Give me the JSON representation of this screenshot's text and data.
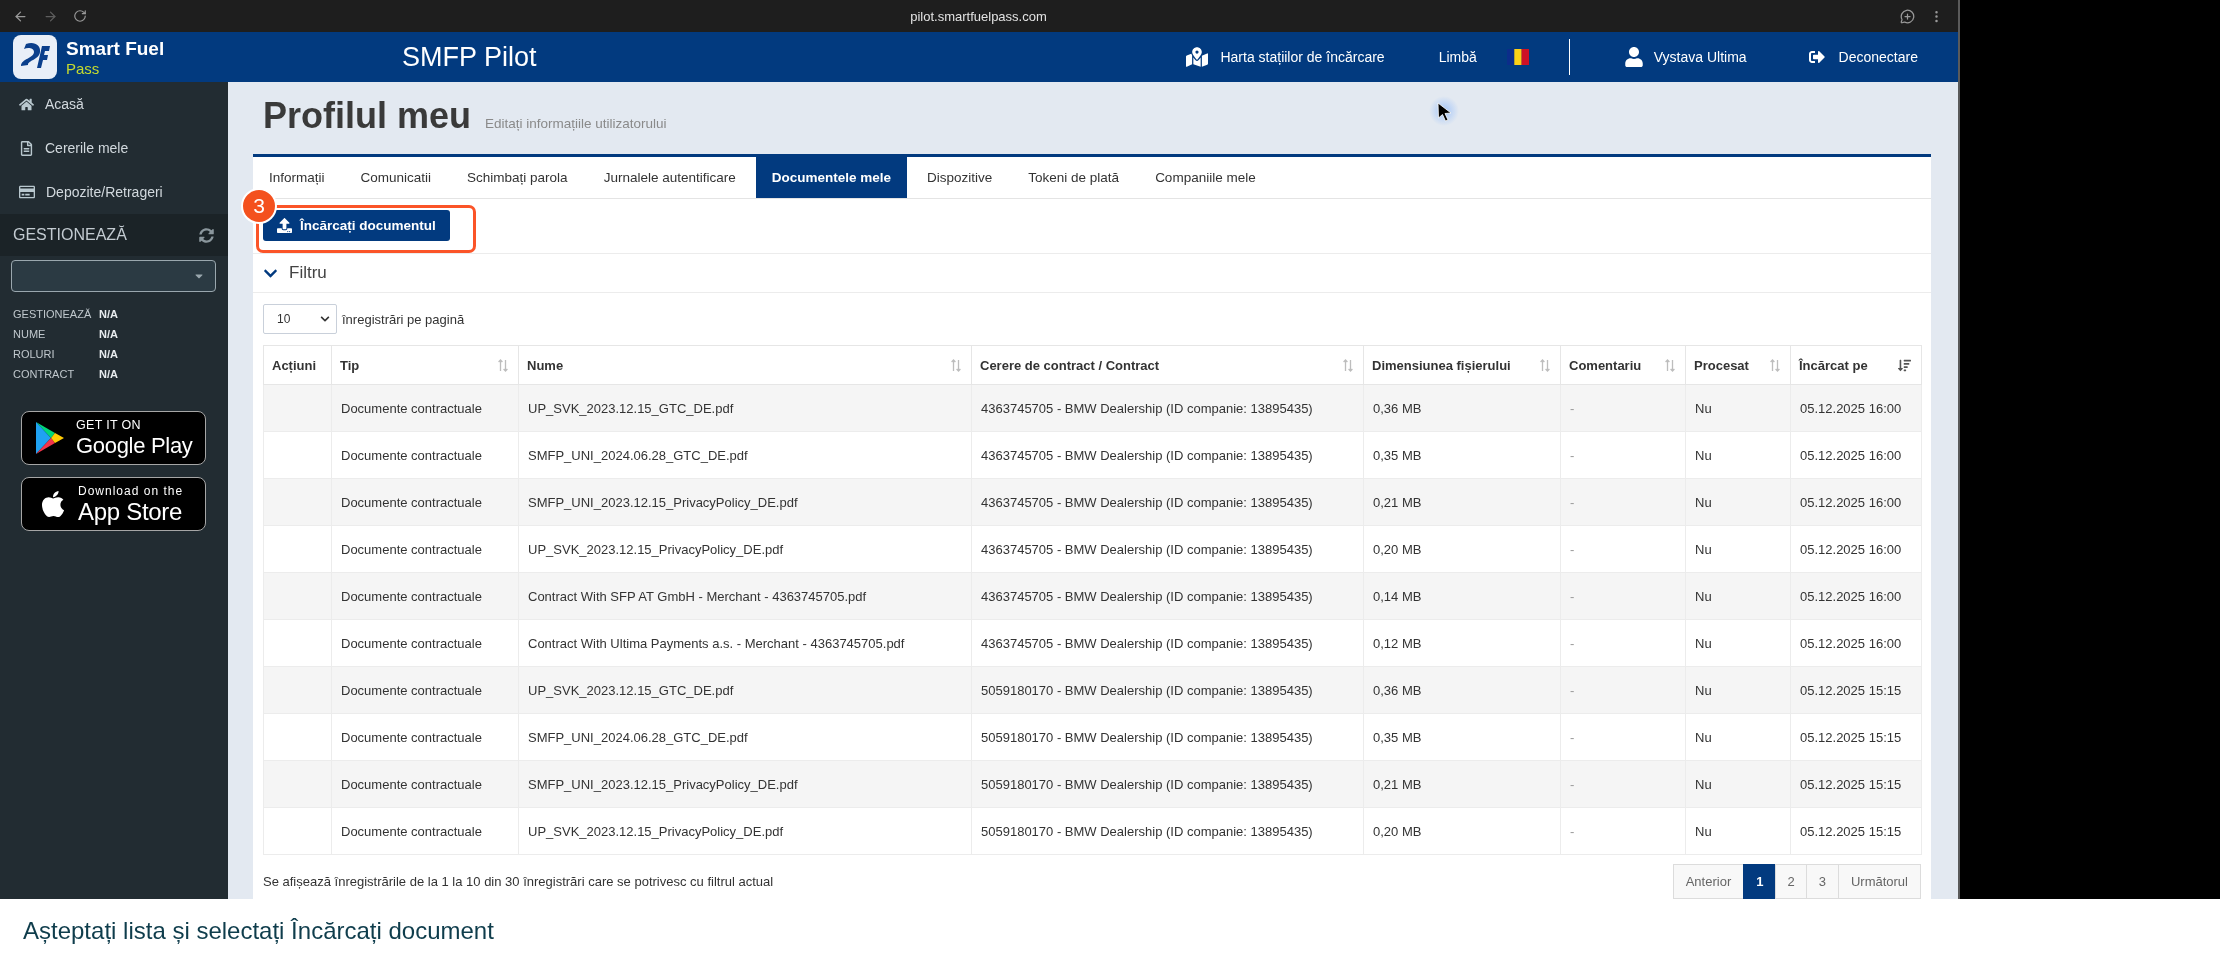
{
  "browser": {
    "url": "pilot.smartfuelpass.com"
  },
  "header": {
    "brand": {
      "name": "Smart Fuel",
      "tagline": "Pass"
    },
    "app_title": "SMFP Pilot",
    "map_link": "Harta stațiilor de încărcare",
    "language_label": "Limbă",
    "user_name": "Vystava Ultima",
    "logout": "Deconectare"
  },
  "sidebar": {
    "nav": [
      {
        "label": "Acasă"
      },
      {
        "label": "Cererile mele"
      },
      {
        "label": "Depozite/Retrageri"
      }
    ],
    "manage": {
      "title": "GESTIONEAZĂ",
      "details": [
        {
          "label": "GESTIONEAZĂ",
          "value": "N/A"
        },
        {
          "label": "NUME",
          "value": "N/A"
        },
        {
          "label": "ROLURI",
          "value": "N/A"
        },
        {
          "label": "CONTRACT",
          "value": "N/A"
        }
      ]
    },
    "stores": [
      {
        "kind": "google_play",
        "top": "GET IT ON",
        "name": "Google Play"
      },
      {
        "kind": "app_store",
        "top": "Download on the",
        "name": "App Store"
      }
    ]
  },
  "page": {
    "title": "Profilul meu",
    "subtitle": "Editați informațiile utilizatorului"
  },
  "tabs": [
    {
      "label": "Informații",
      "selected": false
    },
    {
      "label": "Comunicatii",
      "selected": false
    },
    {
      "label": "Schimbați parola",
      "selected": false
    },
    {
      "label": "Jurnalele autentificare",
      "selected": false
    },
    {
      "label": "Documentele mele",
      "selected": true
    },
    {
      "label": "Dispozitive",
      "selected": false
    },
    {
      "label": "Tokeni de plată",
      "selected": false
    },
    {
      "label": "Companiile mele",
      "selected": false
    }
  ],
  "upload": {
    "label": "Încărcați documentul",
    "step": "3"
  },
  "filter": {
    "label": "Filtru"
  },
  "page_length": {
    "value": "10",
    "label": "înregistrări pe pagină"
  },
  "table": {
    "columns": [
      {
        "label": "Acțiuni",
        "sortable": false,
        "sorted_descending": false
      },
      {
        "label": "Tip",
        "sortable": true,
        "sorted_descending": false
      },
      {
        "label": "Nume",
        "sortable": true,
        "sorted_descending": false
      },
      {
        "label": "Cerere de contract / Contract",
        "sortable": true,
        "sorted_descending": false
      },
      {
        "label": "Dimensiunea fișierului",
        "sortable": true,
        "sorted_descending": false
      },
      {
        "label": "Comentariu",
        "sortable": true,
        "sorted_descending": false
      },
      {
        "label": "Procesat",
        "sortable": true,
        "sorted_descending": false
      },
      {
        "label": "Încărcat pe",
        "sortable": true,
        "sorted_descending": true
      }
    ],
    "rows": [
      {
        "type": "Documente contractuale",
        "name": "UP_SVK_2023.12.15_GTC_DE.pdf",
        "contract": "4363745705 - BMW Dealership (ID companie: 13895435)",
        "size": "0,36 MB",
        "comment": "-",
        "processed": "Nu",
        "uploaded": "05.12.2025 16:00"
      },
      {
        "type": "Documente contractuale",
        "name": "SMFP_UNI_2024.06.28_GTC_DE.pdf",
        "contract": "4363745705 - BMW Dealership (ID companie: 13895435)",
        "size": "0,35 MB",
        "comment": "-",
        "processed": "Nu",
        "uploaded": "05.12.2025 16:00"
      },
      {
        "type": "Documente contractuale",
        "name": "SMFP_UNI_2023.12.15_PrivacyPolicy_DE.pdf",
        "contract": "4363745705 - BMW Dealership (ID companie: 13895435)",
        "size": "0,21 MB",
        "comment": "-",
        "processed": "Nu",
        "uploaded": "05.12.2025 16:00"
      },
      {
        "type": "Documente contractuale",
        "name": "UP_SVK_2023.12.15_PrivacyPolicy_DE.pdf",
        "contract": "4363745705 - BMW Dealership (ID companie: 13895435)",
        "size": "0,20 MB",
        "comment": "-",
        "processed": "Nu",
        "uploaded": "05.12.2025 16:00"
      },
      {
        "type": "Documente contractuale",
        "name": "Contract With SFP AT GmbH - Merchant - 4363745705.pdf",
        "contract": "4363745705 - BMW Dealership (ID companie: 13895435)",
        "size": "0,14 MB",
        "comment": "-",
        "processed": "Nu",
        "uploaded": "05.12.2025 16:00"
      },
      {
        "type": "Documente contractuale",
        "name": "Contract With Ultima Payments a.s. - Merchant - 4363745705.pdf",
        "contract": "4363745705 - BMW Dealership (ID companie: 13895435)",
        "size": "0,12 MB",
        "comment": "-",
        "processed": "Nu",
        "uploaded": "05.12.2025 16:00"
      },
      {
        "type": "Documente contractuale",
        "name": "UP_SVK_2023.12.15_GTC_DE.pdf",
        "contract": "5059180170 - BMW Dealership (ID companie: 13895435)",
        "size": "0,36 MB",
        "comment": "-",
        "processed": "Nu",
        "uploaded": "05.12.2025 15:15"
      },
      {
        "type": "Documente contractuale",
        "name": "SMFP_UNI_2024.06.28_GTC_DE.pdf",
        "contract": "5059180170 - BMW Dealership (ID companie: 13895435)",
        "size": "0,35 MB",
        "comment": "-",
        "processed": "Nu",
        "uploaded": "05.12.2025 15:15"
      },
      {
        "type": "Documente contractuale",
        "name": "SMFP_UNI_2023.12.15_PrivacyPolicy_DE.pdf",
        "contract": "5059180170 - BMW Dealership (ID companie: 13895435)",
        "size": "0,21 MB",
        "comment": "-",
        "processed": "Nu",
        "uploaded": "05.12.2025 15:15"
      },
      {
        "type": "Documente contractuale",
        "name": "UP_SVK_2023.12.15_PrivacyPolicy_DE.pdf",
        "contract": "5059180170 - BMW Dealership (ID companie: 13895435)",
        "size": "0,20 MB",
        "comment": "-",
        "processed": "Nu",
        "uploaded": "05.12.2025 15:15"
      }
    ]
  },
  "footer": {
    "info": "Se afișează înregistrările de la 1 la 10 din 30 înregistrări care se potrivesc cu filtrul actual",
    "pagination": [
      {
        "label": "Anterior",
        "selected": false
      },
      {
        "label": "1",
        "selected": true
      },
      {
        "label": "2",
        "selected": false
      },
      {
        "label": "3",
        "selected": false
      },
      {
        "label": "Următorul",
        "selected": false
      }
    ]
  },
  "caption": "Așteptați lista și selectați Încărcați document"
}
